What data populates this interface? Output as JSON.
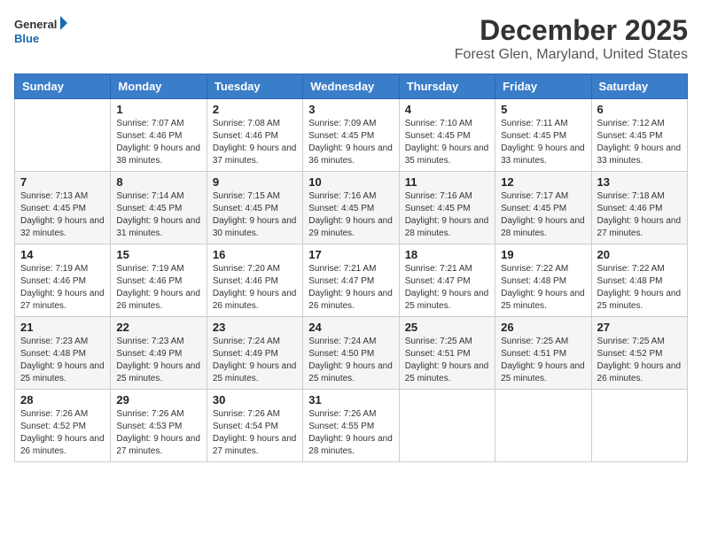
{
  "logo": {
    "line1": "General",
    "line2": "Blue"
  },
  "title": "December 2025",
  "subtitle": "Forest Glen, Maryland, United States",
  "days_of_week": [
    "Sunday",
    "Monday",
    "Tuesday",
    "Wednesday",
    "Thursday",
    "Friday",
    "Saturday"
  ],
  "weeks": [
    [
      {
        "day": "",
        "sunrise": "",
        "sunset": "",
        "daylight": ""
      },
      {
        "day": "1",
        "sunrise": "Sunrise: 7:07 AM",
        "sunset": "Sunset: 4:46 PM",
        "daylight": "Daylight: 9 hours and 38 minutes."
      },
      {
        "day": "2",
        "sunrise": "Sunrise: 7:08 AM",
        "sunset": "Sunset: 4:46 PM",
        "daylight": "Daylight: 9 hours and 37 minutes."
      },
      {
        "day": "3",
        "sunrise": "Sunrise: 7:09 AM",
        "sunset": "Sunset: 4:45 PM",
        "daylight": "Daylight: 9 hours and 36 minutes."
      },
      {
        "day": "4",
        "sunrise": "Sunrise: 7:10 AM",
        "sunset": "Sunset: 4:45 PM",
        "daylight": "Daylight: 9 hours and 35 minutes."
      },
      {
        "day": "5",
        "sunrise": "Sunrise: 7:11 AM",
        "sunset": "Sunset: 4:45 PM",
        "daylight": "Daylight: 9 hours and 33 minutes."
      },
      {
        "day": "6",
        "sunrise": "Sunrise: 7:12 AM",
        "sunset": "Sunset: 4:45 PM",
        "daylight": "Daylight: 9 hours and 33 minutes."
      }
    ],
    [
      {
        "day": "7",
        "sunrise": "Sunrise: 7:13 AM",
        "sunset": "Sunset: 4:45 PM",
        "daylight": "Daylight: 9 hours and 32 minutes."
      },
      {
        "day": "8",
        "sunrise": "Sunrise: 7:14 AM",
        "sunset": "Sunset: 4:45 PM",
        "daylight": "Daylight: 9 hours and 31 minutes."
      },
      {
        "day": "9",
        "sunrise": "Sunrise: 7:15 AM",
        "sunset": "Sunset: 4:45 PM",
        "daylight": "Daylight: 9 hours and 30 minutes."
      },
      {
        "day": "10",
        "sunrise": "Sunrise: 7:16 AM",
        "sunset": "Sunset: 4:45 PM",
        "daylight": "Daylight: 9 hours and 29 minutes."
      },
      {
        "day": "11",
        "sunrise": "Sunrise: 7:16 AM",
        "sunset": "Sunset: 4:45 PM",
        "daylight": "Daylight: 9 hours and 28 minutes."
      },
      {
        "day": "12",
        "sunrise": "Sunrise: 7:17 AM",
        "sunset": "Sunset: 4:45 PM",
        "daylight": "Daylight: 9 hours and 28 minutes."
      },
      {
        "day": "13",
        "sunrise": "Sunrise: 7:18 AM",
        "sunset": "Sunset: 4:46 PM",
        "daylight": "Daylight: 9 hours and 27 minutes."
      }
    ],
    [
      {
        "day": "14",
        "sunrise": "Sunrise: 7:19 AM",
        "sunset": "Sunset: 4:46 PM",
        "daylight": "Daylight: 9 hours and 27 minutes."
      },
      {
        "day": "15",
        "sunrise": "Sunrise: 7:19 AM",
        "sunset": "Sunset: 4:46 PM",
        "daylight": "Daylight: 9 hours and 26 minutes."
      },
      {
        "day": "16",
        "sunrise": "Sunrise: 7:20 AM",
        "sunset": "Sunset: 4:46 PM",
        "daylight": "Daylight: 9 hours and 26 minutes."
      },
      {
        "day": "17",
        "sunrise": "Sunrise: 7:21 AM",
        "sunset": "Sunset: 4:47 PM",
        "daylight": "Daylight: 9 hours and 26 minutes."
      },
      {
        "day": "18",
        "sunrise": "Sunrise: 7:21 AM",
        "sunset": "Sunset: 4:47 PM",
        "daylight": "Daylight: 9 hours and 25 minutes."
      },
      {
        "day": "19",
        "sunrise": "Sunrise: 7:22 AM",
        "sunset": "Sunset: 4:48 PM",
        "daylight": "Daylight: 9 hours and 25 minutes."
      },
      {
        "day": "20",
        "sunrise": "Sunrise: 7:22 AM",
        "sunset": "Sunset: 4:48 PM",
        "daylight": "Daylight: 9 hours and 25 minutes."
      }
    ],
    [
      {
        "day": "21",
        "sunrise": "Sunrise: 7:23 AM",
        "sunset": "Sunset: 4:48 PM",
        "daylight": "Daylight: 9 hours and 25 minutes."
      },
      {
        "day": "22",
        "sunrise": "Sunrise: 7:23 AM",
        "sunset": "Sunset: 4:49 PM",
        "daylight": "Daylight: 9 hours and 25 minutes."
      },
      {
        "day": "23",
        "sunrise": "Sunrise: 7:24 AM",
        "sunset": "Sunset: 4:49 PM",
        "daylight": "Daylight: 9 hours and 25 minutes."
      },
      {
        "day": "24",
        "sunrise": "Sunrise: 7:24 AM",
        "sunset": "Sunset: 4:50 PM",
        "daylight": "Daylight: 9 hours and 25 minutes."
      },
      {
        "day": "25",
        "sunrise": "Sunrise: 7:25 AM",
        "sunset": "Sunset: 4:51 PM",
        "daylight": "Daylight: 9 hours and 25 minutes."
      },
      {
        "day": "26",
        "sunrise": "Sunrise: 7:25 AM",
        "sunset": "Sunset: 4:51 PM",
        "daylight": "Daylight: 9 hours and 25 minutes."
      },
      {
        "day": "27",
        "sunrise": "Sunrise: 7:25 AM",
        "sunset": "Sunset: 4:52 PM",
        "daylight": "Daylight: 9 hours and 26 minutes."
      }
    ],
    [
      {
        "day": "28",
        "sunrise": "Sunrise: 7:26 AM",
        "sunset": "Sunset: 4:52 PM",
        "daylight": "Daylight: 9 hours and 26 minutes."
      },
      {
        "day": "29",
        "sunrise": "Sunrise: 7:26 AM",
        "sunset": "Sunset: 4:53 PM",
        "daylight": "Daylight: 9 hours and 27 minutes."
      },
      {
        "day": "30",
        "sunrise": "Sunrise: 7:26 AM",
        "sunset": "Sunset: 4:54 PM",
        "daylight": "Daylight: 9 hours and 27 minutes."
      },
      {
        "day": "31",
        "sunrise": "Sunrise: 7:26 AM",
        "sunset": "Sunset: 4:55 PM",
        "daylight": "Daylight: 9 hours and 28 minutes."
      },
      {
        "day": "",
        "sunrise": "",
        "sunset": "",
        "daylight": ""
      },
      {
        "day": "",
        "sunrise": "",
        "sunset": "",
        "daylight": ""
      },
      {
        "day": "",
        "sunrise": "",
        "sunset": "",
        "daylight": ""
      }
    ]
  ]
}
